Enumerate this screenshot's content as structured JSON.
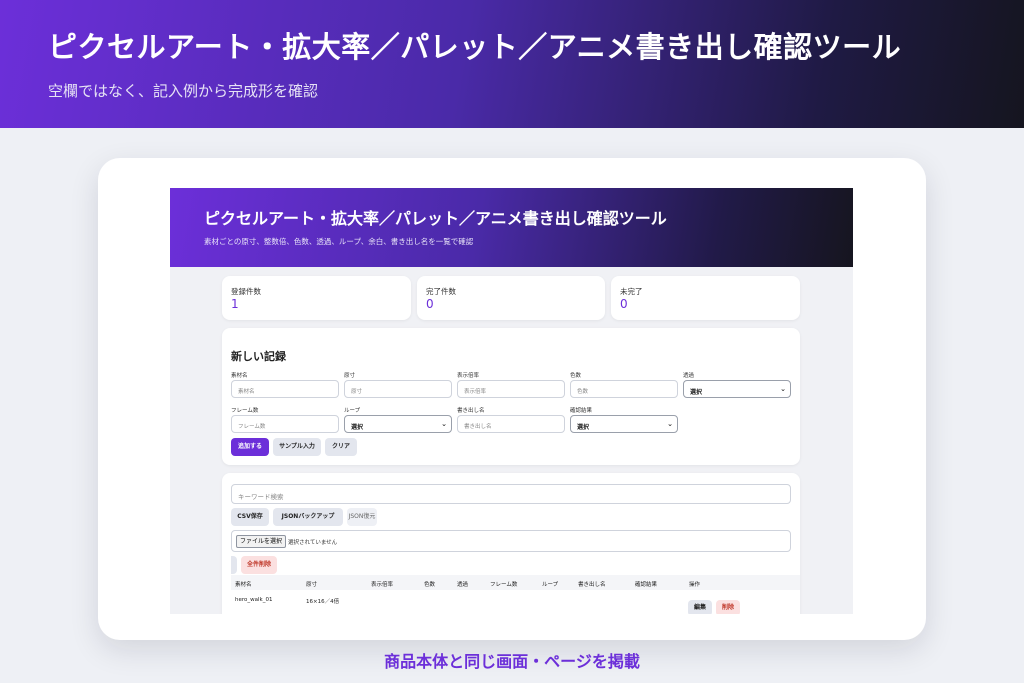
{
  "hero": {
    "title": "ピクセルアート・拡大率／パレット／アニメ書き出し確認ツール",
    "subtitle": "空欄ではなく、記入例から完成形を確認"
  },
  "app": {
    "title": "ピクセルアート・拡大率／パレット／アニメ書き出し確認ツール",
    "subtitle": "素材ごとの原寸、整数倍、色数、透過、ループ、余白、書き出し名を一覧で確認"
  },
  "stats": [
    {
      "label": "登録件数",
      "value": "1"
    },
    {
      "label": "完了件数",
      "value": "0"
    },
    {
      "label": "未完了",
      "value": "0"
    }
  ],
  "form": {
    "heading": "新しい記録",
    "fields": {
      "name": {
        "label": "素材名",
        "placeholder": "素材名"
      },
      "size": {
        "label": "原寸",
        "placeholder": "原寸"
      },
      "scale": {
        "label": "表示倍率",
        "placeholder": "表示倍率"
      },
      "colors": {
        "label": "色数",
        "placeholder": "色数"
      },
      "transparency": {
        "label": "透過",
        "value": "選択"
      },
      "frames": {
        "label": "フレーム数",
        "placeholder": "フレーム数"
      },
      "loop": {
        "label": "ループ",
        "value": "選択"
      },
      "export_name": {
        "label": "書き出し名",
        "placeholder": "書き出し名"
      },
      "result": {
        "label": "確認結果",
        "value": "選択"
      }
    },
    "buttons": {
      "add": "追加する",
      "sample": "サンプル入力",
      "clear": "クリア"
    }
  },
  "data_panel": {
    "search_placeholder": "キーワード検索",
    "buttons": {
      "csv": "CSV保存",
      "json_backup": "JSONバックアップ",
      "json_restore": "JSON復元",
      "delete_all": "全件削除"
    },
    "file": {
      "button": "ファイルを選択",
      "status": "選択されていません"
    }
  },
  "table": {
    "headers": [
      "素材名",
      "原寸",
      "表示倍率",
      "色数",
      "透過",
      "フレーム数",
      "ループ",
      "書き出し名",
      "確認結果",
      "操作"
    ],
    "rows": [
      {
        "name": "hero_walk_01",
        "size": "16×16／4倍",
        "edit": "編集",
        "delete": "削除"
      }
    ]
  },
  "caption": "商品本体と同じ画面・ページを掲載"
}
